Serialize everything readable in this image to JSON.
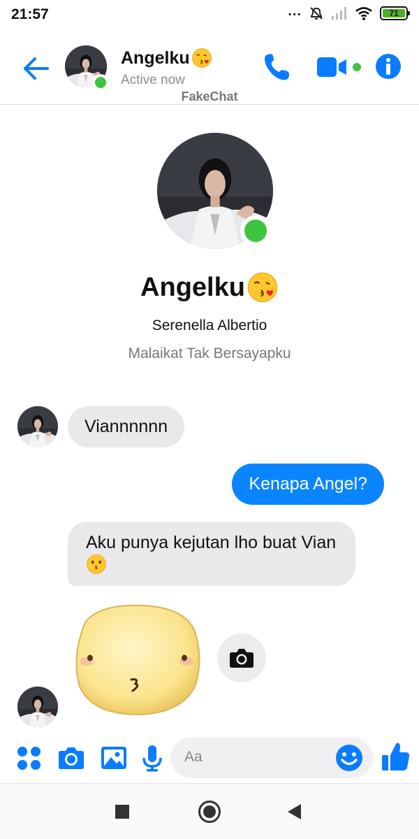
{
  "status_bar": {
    "time": "21:57",
    "dots": "...",
    "battery": "71",
    "icons": [
      "dnd-off-icon",
      "signal-icon",
      "wifi-icon",
      "battery-icon"
    ]
  },
  "header": {
    "name": "Angelku",
    "name_emoji": "face-blowing-kiss",
    "status": "Active now",
    "watermark": "FakeChat",
    "icons": [
      "back-arrow-icon",
      "phone-icon",
      "video-camera-icon",
      "info-icon"
    ],
    "accent_color": "#0a7cff",
    "online_color": "#3ec43e"
  },
  "profile": {
    "name": "Angelku",
    "name_emoji": "face-blowing-kiss",
    "real_name": "Serenella Albertio",
    "bio": "Malaikat Tak Bersayapku"
  },
  "messages": [
    {
      "direction": "incoming",
      "text": "Viannnnnn"
    },
    {
      "direction": "outgoing",
      "text": "Kenapa Angel?"
    },
    {
      "direction": "incoming",
      "text": "Aku punya kejutan lho buat Vian",
      "emoji": "kissing-face"
    },
    {
      "direction": "incoming",
      "type": "sticker",
      "sticker": "kissing-face-sticker"
    }
  ],
  "composer": {
    "placeholder": "Aa",
    "icons": [
      "apps-grid-icon",
      "camera-icon",
      "gallery-icon",
      "microphone-icon",
      "emoji-icon",
      "thumbs-up-icon"
    ]
  },
  "navbar": {
    "icons": [
      "recents-square-icon",
      "home-circle-icon",
      "back-triangle-icon"
    ]
  },
  "colors": {
    "outgoing_bubble": "#0a84ff",
    "incoming_bubble": "#e9e9eb"
  }
}
